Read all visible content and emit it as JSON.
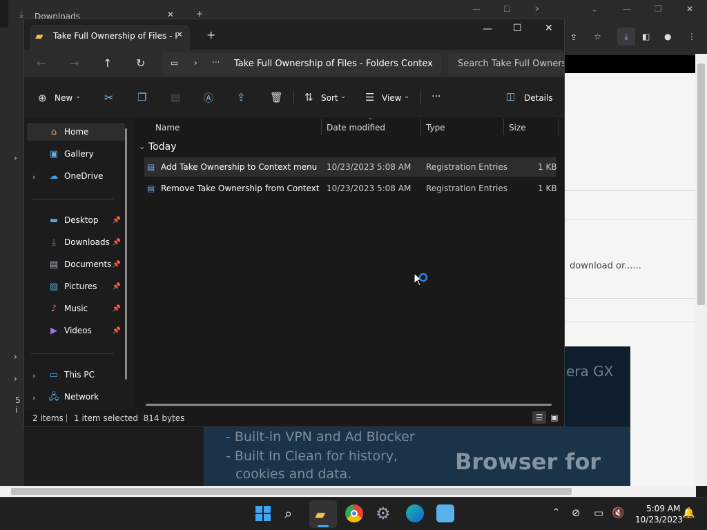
{
  "background": {
    "browser_tab_title": "Downloads",
    "snippet_download": "download or......",
    "banner_line1": "- Built-in VPN and Ad Blocker",
    "banner_line2": "- Built In Clean for history,",
    "banner_line3": "cookies and data.",
    "banner_brand": "era GX",
    "banner_tagline": "Browser for",
    "left_count": "5 i"
  },
  "explorer": {
    "tab_title": "Take Full Ownership of Files - I",
    "breadcrumb": "Take Full Ownership of Files - Folders Contex",
    "search_placeholder": "Search Take Full Ownersh",
    "toolbar": {
      "new_label": "New",
      "sort_label": "Sort",
      "view_label": "View",
      "more_label": "···",
      "details_label": "Details"
    },
    "nav": {
      "home": "Home",
      "gallery": "Gallery",
      "onedrive": "OneDrive",
      "desktop": "Desktop",
      "downloads": "Downloads",
      "documents": "Documents",
      "pictures": "Pictures",
      "music": "Music",
      "videos": "Videos",
      "thispc": "This PC",
      "network": "Network"
    },
    "columns": {
      "name": "Name",
      "date": "Date modified",
      "type": "Type",
      "size": "Size"
    },
    "group_label": "Today",
    "files": [
      {
        "name": "Add Take Ownership to Context menu",
        "date": "10/23/2023 5:08 AM",
        "type": "Registration Entries",
        "size": "1 KB"
      },
      {
        "name": "Remove Take Ownership from Context M...",
        "date": "10/23/2023 5:08 AM",
        "type": "Registration Entries",
        "size": "1 KB"
      }
    ],
    "status": {
      "items": "2 items",
      "selected": "1 item selected  814 bytes"
    }
  },
  "taskbar": {
    "time": "5:09 AM",
    "date": "10/23/2023"
  },
  "colors": {
    "accent": "#0078d4",
    "selected_row": "#2d2d2d",
    "window_bg": "#191919"
  }
}
